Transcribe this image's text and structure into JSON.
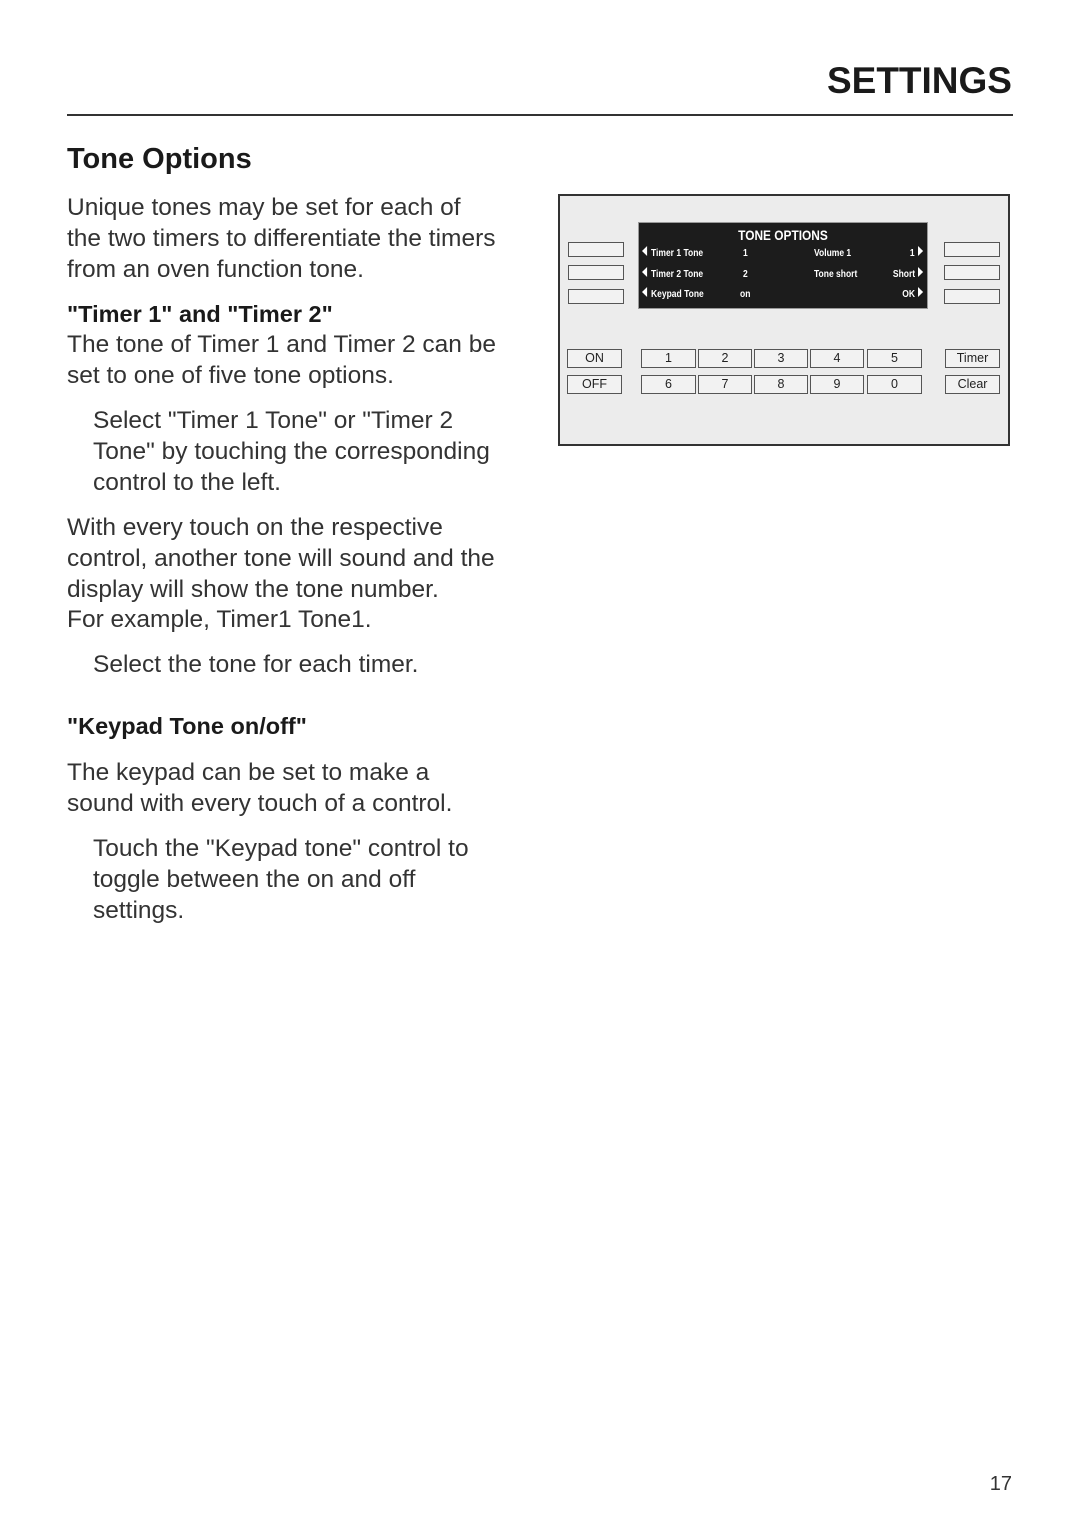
{
  "header": {
    "section": "SETTINGS"
  },
  "title": "Tone Options",
  "intro": [
    "Unique tones may be set for each of",
    "the two timers to differentiate the timers",
    "from an oven function tone."
  ],
  "timer_heading": "\"Timer 1\" and \"Timer 2\"",
  "timer_text": [
    "The tone of Timer 1 and Timer 2 can be",
    "set to one of five tone options."
  ],
  "timer_step": [
    "Select \"Timer 1 Tone\" or \"Timer 2",
    "Tone\" by touching the corresponding",
    "control to the left."
  ],
  "touch_text": [
    "With every touch on the respective",
    "control, another tone will sound and the",
    "display will show the tone number.",
    "For example, Timer1 Tone1."
  ],
  "select_step": [
    "Select the tone for each timer."
  ],
  "keypad_heading": "\"Keypad Tone on/off\"",
  "keypad_text": [
    "The keypad can be set to make a",
    "sound with every touch of a control."
  ],
  "keypad_step": [
    "Touch the \"Keypad tone\" control to",
    "toggle between the on and off",
    "settings."
  ],
  "panel": {
    "display": {
      "title": "TONE OPTIONS",
      "rows": [
        {
          "left_label": "Timer 1 Tone",
          "left_value": "1",
          "right_label": "Volume 1",
          "right_value": "1"
        },
        {
          "left_label": "Timer 2 Tone",
          "left_value": "2",
          "right_label": "Tone short",
          "right_value": "Short"
        },
        {
          "left_label": "Keypad Tone",
          "left_value": "on",
          "right_label": "",
          "right_value": "OK"
        }
      ]
    },
    "on": "ON",
    "off": "OFF",
    "digits_row1": [
      "1",
      "2",
      "3",
      "4",
      "5"
    ],
    "digits_row2": [
      "6",
      "7",
      "8",
      "9",
      "0"
    ],
    "timer": "Timer",
    "clear": "Clear"
  },
  "page_number": "17"
}
